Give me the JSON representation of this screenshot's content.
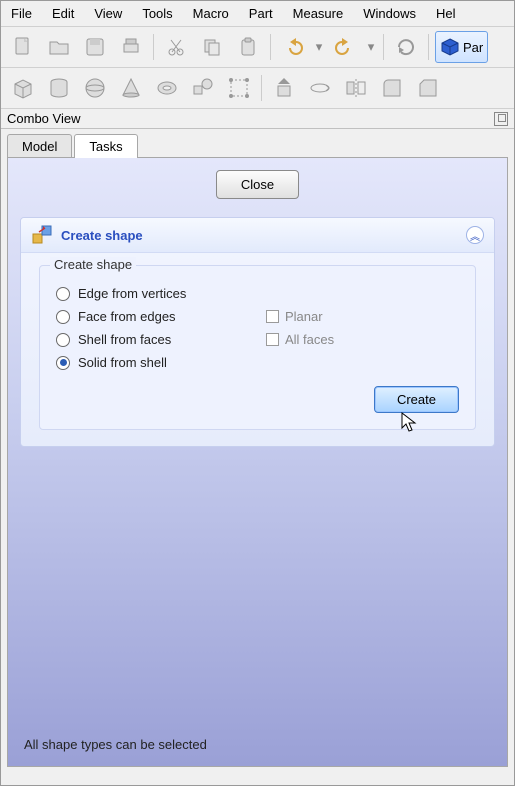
{
  "menubar": {
    "items": [
      "File",
      "Edit",
      "View",
      "Tools",
      "Macro",
      "Part",
      "Measure",
      "Windows",
      "Hel"
    ]
  },
  "toolbar": {
    "part_label": "Par"
  },
  "combo_view": {
    "title": "Combo View"
  },
  "tabs": {
    "items": [
      "Model",
      "Tasks"
    ],
    "active_index": 1
  },
  "task": {
    "close_label": "Close",
    "group_title": "Create shape",
    "fieldset_legend": "Create shape",
    "options": [
      {
        "label": "Edge from vertices",
        "checked": false,
        "extra": null
      },
      {
        "label": "Face from edges",
        "checked": false,
        "extra": {
          "label": "Planar",
          "checked": false
        }
      },
      {
        "label": "Shell from faces",
        "checked": false,
        "extra": {
          "label": "All faces",
          "checked": false
        }
      },
      {
        "label": "Solid from shell",
        "checked": true,
        "extra": null
      }
    ],
    "create_label": "Create",
    "status_text": "All shape types can be selected"
  }
}
